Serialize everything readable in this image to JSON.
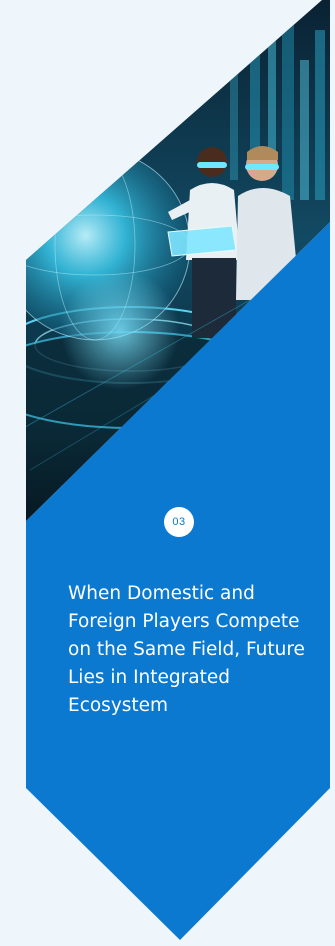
{
  "card": {
    "step_number": "03",
    "title": "When Domestic and Foreign Players Compete on the Same Field, Future Lies in Integrated Ecosystem",
    "image_subject": "vr-headset-people-hologram",
    "colors": {
      "page_background": "#eef5fb",
      "card_blue": "#0b79d0",
      "badge_background": "#ffffff",
      "title_text": "#ffffff"
    }
  }
}
